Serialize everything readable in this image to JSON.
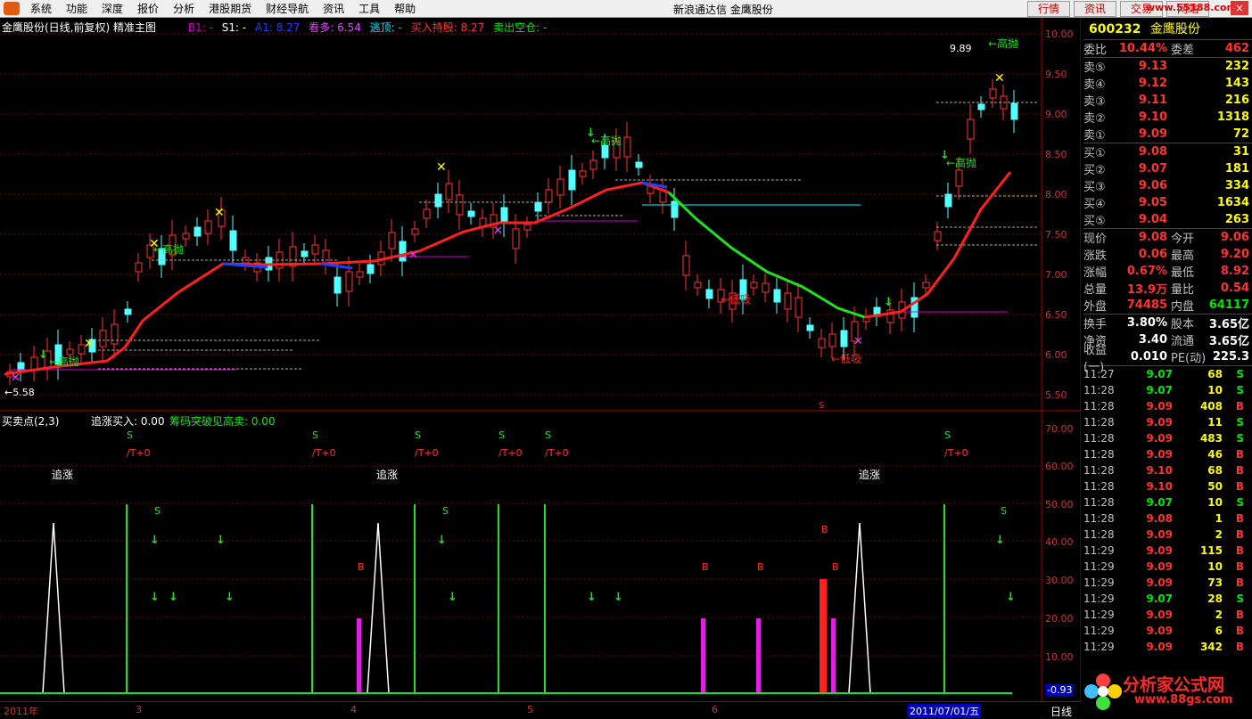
{
  "menu": {
    "items": [
      "系统",
      "功能",
      "深度",
      "报价",
      "分析",
      "港股期货",
      "财经导航",
      "资讯",
      "工具",
      "帮助"
    ],
    "title": "新浪通达信 金鹰股份",
    "right_buttons": [
      "行情",
      "资讯",
      "交易",
      "网站"
    ],
    "watermark": "www.55188.com"
  },
  "chart": {
    "name": "金鹰股份(日线,前复权) 精准主图",
    "b1": "B1: -",
    "s1": "S1: -",
    "a1": "A1: 8.27",
    "kanduo": "看多: 6.54",
    "taoding": "逃顶: -",
    "mairu": "买入持股: 8.27",
    "maichu": "卖出空仓: -",
    "high_label": "9.89",
    "low_label": "←5.58",
    "gaopao": "←高抛",
    "dixi": "←低吸",
    "price_axis": [
      "10.00",
      "9.50",
      "9.00",
      "8.50",
      "8.00",
      "7.50",
      "7.00",
      "6.50",
      "6.00",
      "5.50"
    ],
    "marker_s": "S"
  },
  "sub": {
    "title": "买卖点(2,3)",
    "zhuizhang_buy": "追涨买入: 0.00",
    "chouma": "筹码突破见高卖: 0.00",
    "zhuizhang": "追涨",
    "t0": "/T+0",
    "s": "S",
    "b": "B",
    "axis": [
      "70.00",
      "60.00",
      "50.00",
      "40.00",
      "30.00",
      "20.00",
      "10.00"
    ],
    "current": "-0.93"
  },
  "timeline": {
    "labels": [
      "2011年",
      "3",
      "4",
      "5",
      "6"
    ],
    "cursor": "2011/07/01/五",
    "period": "日线"
  },
  "quote": {
    "code": "600232",
    "name": "金鹰股份",
    "weibi_label": "委比",
    "weibi": "10.44%",
    "weicha_label": "委差",
    "weicha": "462",
    "asks": [
      {
        "label": "卖⑤",
        "price": "9.13",
        "vol": "232"
      },
      {
        "label": "卖④",
        "price": "9.12",
        "vol": "143"
      },
      {
        "label": "卖③",
        "price": "9.11",
        "vol": "216"
      },
      {
        "label": "卖②",
        "price": "9.10",
        "vol": "1318"
      },
      {
        "label": "卖①",
        "price": "9.09",
        "vol": "72"
      }
    ],
    "bids": [
      {
        "label": "买①",
        "price": "9.08",
        "vol": "31"
      },
      {
        "label": "买②",
        "price": "9.07",
        "vol": "181"
      },
      {
        "label": "买③",
        "price": "9.06",
        "vol": "334"
      },
      {
        "label": "买④",
        "price": "9.05",
        "vol": "1634"
      },
      {
        "label": "买⑤",
        "price": "9.04",
        "vol": "263"
      }
    ],
    "stats": [
      {
        "l1": "现价",
        "v1": "9.08",
        "l2": "今开",
        "v2": "9.06"
      },
      {
        "l1": "涨跌",
        "v1": "0.06",
        "l2": "最高",
        "v2": "9.20"
      },
      {
        "l1": "涨幅",
        "v1": "0.67%",
        "l2": "最低",
        "v2": "8.92"
      },
      {
        "l1": "总量",
        "v1": "13.9万",
        "l2": "量比",
        "v2": "0.54"
      },
      {
        "l1": "外盘",
        "v1": "74485",
        "l2": "内盘",
        "v2": "64117"
      }
    ],
    "stats2": [
      {
        "l1": "换手",
        "v1": "3.80%",
        "l2": "股本",
        "v2": "3.65亿"
      },
      {
        "l1": "净资",
        "v1": "3.40",
        "l2": "流通",
        "v2": "3.65亿"
      },
      {
        "l1": "收益(一)",
        "v1": "0.010",
        "l2": "PE(动)",
        "v2": "225.3"
      }
    ],
    "ticks": [
      {
        "t": "11:27",
        "p": "9.07",
        "q": "68",
        "s": "S"
      },
      {
        "t": "11:28",
        "p": "9.07",
        "q": "10",
        "s": "S"
      },
      {
        "t": "11:28",
        "p": "9.09",
        "q": "408",
        "s": "B"
      },
      {
        "t": "11:28",
        "p": "9.09",
        "q": "11",
        "s": "S"
      },
      {
        "t": "11:28",
        "p": "9.09",
        "q": "483",
        "s": "S"
      },
      {
        "t": "11:28",
        "p": "9.09",
        "q": "46",
        "s": "B"
      },
      {
        "t": "11:28",
        "p": "9.10",
        "q": "68",
        "s": "B"
      },
      {
        "t": "11:28",
        "p": "9.10",
        "q": "50",
        "s": "B"
      },
      {
        "t": "11:28",
        "p": "9.07",
        "q": "10",
        "s": "S"
      },
      {
        "t": "11:28",
        "p": "9.08",
        "q": "1",
        "s": "B"
      },
      {
        "t": "11:28",
        "p": "9.09",
        "q": "2",
        "s": "B"
      },
      {
        "t": "11:29",
        "p": "9.09",
        "q": "115",
        "s": "B"
      },
      {
        "t": "11:29",
        "p": "9.09",
        "q": "10",
        "s": "B"
      },
      {
        "t": "11:29",
        "p": "9.09",
        "q": "73",
        "s": "B"
      },
      {
        "t": "11:29",
        "p": "9.07",
        "q": "28",
        "s": "S"
      },
      {
        "t": "11:29",
        "p": "9.09",
        "q": "2",
        "s": "B"
      },
      {
        "t": "11:29",
        "p": "9.09",
        "q": "6",
        "s": "B"
      },
      {
        "t": "11:29",
        "p": "9.09",
        "q": "342",
        "s": "B"
      }
    ]
  },
  "brand": {
    "name": "分析家公式网",
    "url": "www.88gs.com"
  }
}
